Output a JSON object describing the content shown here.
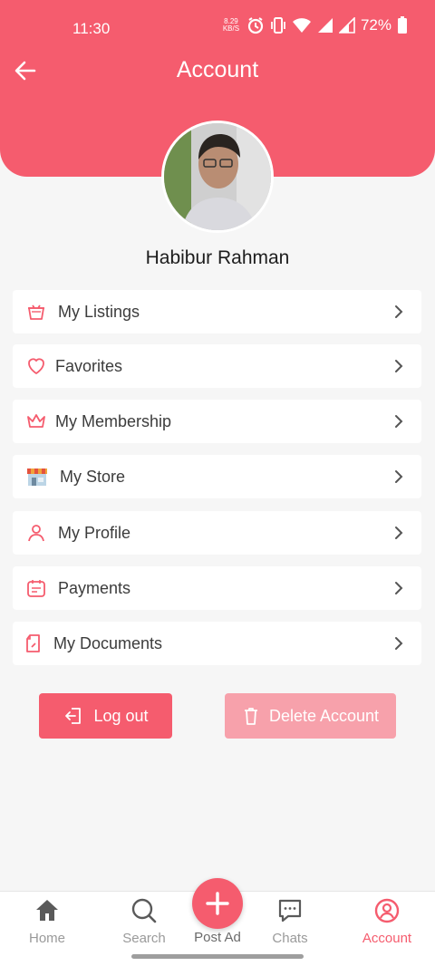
{
  "status": {
    "time": "11:30",
    "net_speed_top": "8.29",
    "net_speed_bottom": "KB/S",
    "battery": "72%"
  },
  "header": {
    "title": "Account",
    "back_icon": "arrow-left-icon"
  },
  "profile": {
    "name": "Habibur Rahman"
  },
  "menu": [
    {
      "label": "My Listings",
      "icon": "basket-icon"
    },
    {
      "label": "Favorites",
      "icon": "heart-icon"
    },
    {
      "label": "My Membership",
      "icon": "crown-icon"
    },
    {
      "label": "My Store",
      "icon": "store-icon"
    },
    {
      "label": "My Profile",
      "icon": "user-icon"
    },
    {
      "label": "Payments",
      "icon": "calendar-icon"
    },
    {
      "label": "My Documents",
      "icon": "document-icon"
    }
  ],
  "actions": {
    "logout": "Log out",
    "delete": "Delete Account"
  },
  "bottom_nav": {
    "home": "Home",
    "search": "Search",
    "post_ad": "Post Ad",
    "chats": "Chats",
    "account": "Account",
    "active": "Account"
  },
  "colors": {
    "accent": "#f55c6e",
    "accent_light": "#f7a1ab",
    "background": "#f6f6f6"
  }
}
